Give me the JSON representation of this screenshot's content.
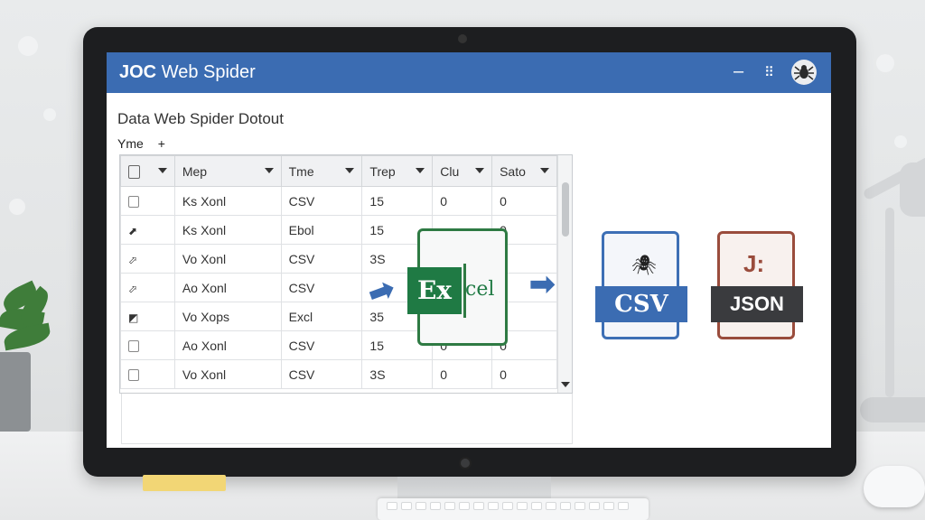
{
  "app": {
    "title_bold": "JOC",
    "title_rest": "Web Spider",
    "min_glyph": "–",
    "grid_glyph": "⠿",
    "spider_glyph": "🕷"
  },
  "page": {
    "title": "Data Web Spider Dotout",
    "filter_label": "Yme",
    "filter_plus": "+"
  },
  "table": {
    "columns": [
      "Mep",
      "Tme",
      "Trep",
      "Clu",
      "Sato"
    ],
    "rows": [
      {
        "icon": "",
        "name": "Ks Xonl",
        "type": "CSV",
        "trep": "15",
        "clu": "0",
        "sato": "0"
      },
      {
        "icon": "⬈",
        "name": "Ks Xonl",
        "type": "Ebol",
        "trep": "15",
        "clu": "",
        "sato": "0"
      },
      {
        "icon": "⬀",
        "name": "Vo Xonl",
        "type": "CSV",
        "trep": "3S",
        "clu": "",
        "sato": ""
      },
      {
        "icon": "⬀",
        "name": "Ao Xonl",
        "type": "CSV",
        "trep": "",
        "clu": "",
        "sato": ""
      },
      {
        "icon": "◩",
        "name": "Vo Xops",
        "type": "Excl",
        "trep": "35",
        "clu": "",
        "sato": ""
      },
      {
        "icon": "",
        "name": "Ao Xonl",
        "type": "CSV",
        "trep": "15",
        "clu": "0",
        "sato": "0"
      },
      {
        "icon": "",
        "name": "Vo Xonl",
        "type": "CSV",
        "trep": "3S",
        "clu": "0",
        "sato": "0"
      }
    ]
  },
  "export": {
    "excel_badge": "Ex",
    "excel_rest": "cel",
    "csv_label": "CSV",
    "json_label": "JSON",
    "json_glyph": "J:",
    "arrow_glyph": "➡",
    "colors": {
      "excel": "#1f7a44",
      "csv": "#3b6cb2",
      "json": "#9a4c3c",
      "titlebar": "#3b6cb2"
    }
  }
}
